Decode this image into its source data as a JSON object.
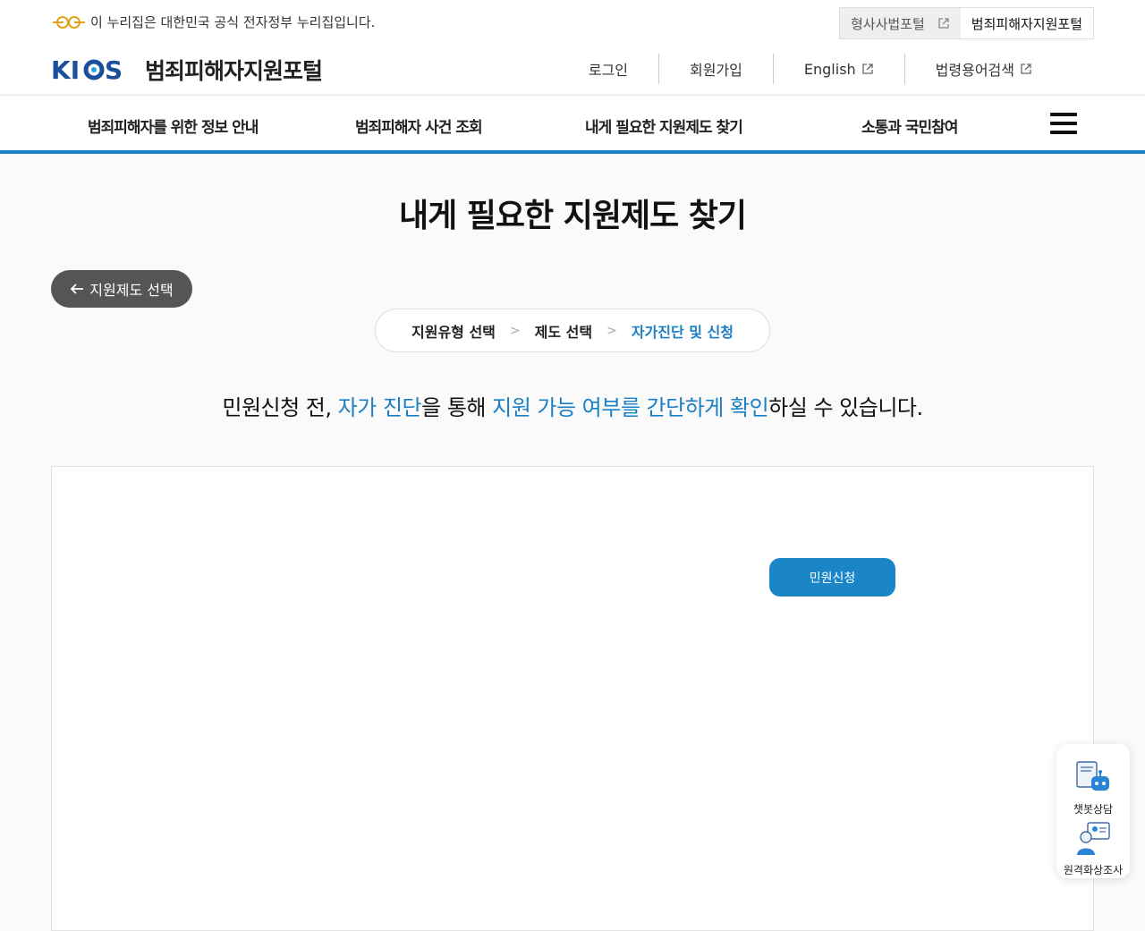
{
  "topbar": {
    "gov_notice": "이 누리집은 대한민국 공식 전자정부 누리집입니다.",
    "portal_links": [
      {
        "label": "형사사법포털"
      },
      {
        "label": "범죄피해자지원포털"
      }
    ]
  },
  "header": {
    "logo_text": "범죄피해자지원포털",
    "util": [
      {
        "label": "로그인"
      },
      {
        "label": "회원가입"
      },
      {
        "label": "English"
      },
      {
        "label": "법령용어검색"
      }
    ]
  },
  "gnb": {
    "items": [
      {
        "label": "범죄피해자를 위한 정보 안내"
      },
      {
        "label": "범죄피해자 사건 조회"
      },
      {
        "label": "내게 필요한 지원제도 찾기"
      },
      {
        "label": "소통과 국민참여"
      }
    ]
  },
  "main": {
    "page_title": "내게 필요한 지원제도 찾기",
    "back_label": "지원제도 선택",
    "steps": [
      {
        "label": "지원유형 선택"
      },
      {
        "label": "제도 선택"
      },
      {
        "label": "자가진단 및 신청"
      }
    ],
    "step_separator": ">",
    "lead": {
      "p1": "민원신청 전, ",
      "h1": "자가 진단",
      "p2": "을 통해 ",
      "h2": "지원 가능 여부를 간단하게 확인",
      "p3": "하실 수 있습니다."
    },
    "apply_label": "민원신청"
  },
  "quick_menu": [
    {
      "label": "챗봇상담",
      "icon": "chatbot-icon"
    },
    {
      "label": "원격화상조사",
      "icon": "video-call-icon"
    }
  ],
  "colors": {
    "accent": "#1a7fc3",
    "button": "#1a86c8",
    "back_button": "#555555"
  }
}
